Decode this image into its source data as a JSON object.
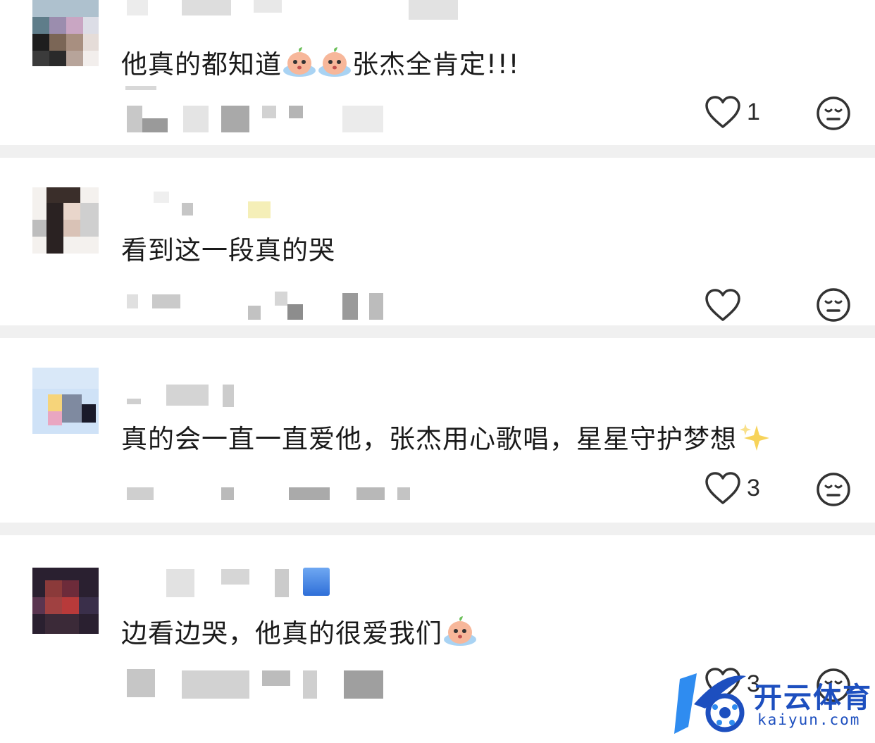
{
  "comments": [
    {
      "text_parts": [
        "他真的都知道",
        "张杰全肯定!!!"
      ],
      "emojis": [
        "crying-peach-emoji",
        "crying-peach-emoji"
      ],
      "likes": "1"
    },
    {
      "text": "看到这一段真的哭",
      "likes": ""
    },
    {
      "text": "真的会一直一直爱他，张杰用心歌唱，星星守护梦想",
      "emojis": [
        "sparkles-emoji"
      ],
      "likes": "3"
    },
    {
      "text": "边看边哭，他真的很爱我们",
      "emojis": [
        "crying-peach-emoji"
      ],
      "likes": "3"
    }
  ],
  "icons": {
    "like": "heart-outline-icon",
    "dislike": "expressionless-face-icon"
  },
  "colors": {
    "divider": "#f0f0f0",
    "icon_stroke": "#333333",
    "watermark": "#1d4fbf"
  },
  "watermark": {
    "cn": "开云体育",
    "en": "kaiyun.com"
  }
}
